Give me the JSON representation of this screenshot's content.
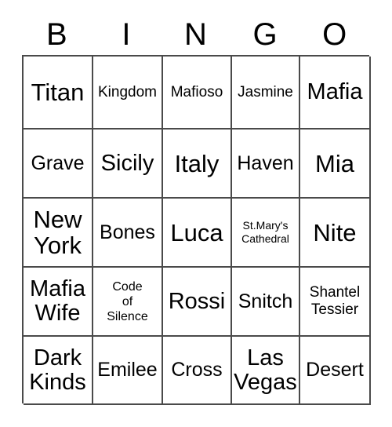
{
  "card": {
    "title": "BINGO",
    "header_letters": [
      "B",
      "I",
      "N",
      "G",
      "O"
    ],
    "border_color": "#4a4a4a",
    "background_color": "#ffffff",
    "text_color": "#000000",
    "columns": 5,
    "rows": 5
  },
  "grid": {
    "rows": [
      {
        "cells": [
          {
            "text": "Titan",
            "size": "xl"
          },
          {
            "text": "Kingdom",
            "size": "sm"
          },
          {
            "text": "Mafioso",
            "size": "sm"
          },
          {
            "text": "Jasmine",
            "size": "sm"
          },
          {
            "text": "Mafia",
            "size": "lg"
          }
        ]
      },
      {
        "cells": [
          {
            "text": "Grave",
            "size": "md"
          },
          {
            "text": "Sicily",
            "size": "lg"
          },
          {
            "text": "Italy",
            "size": "xl"
          },
          {
            "text": "Haven",
            "size": "md"
          },
          {
            "text": "Mia",
            "size": "xl"
          }
        ]
      },
      {
        "cells": [
          {
            "text": "New\nYork",
            "size": "xl"
          },
          {
            "text": "Bones",
            "size": "md"
          },
          {
            "text": "Luca",
            "size": "xl"
          },
          {
            "text": "St.Mary's\nCathedral",
            "size": "xxs"
          },
          {
            "text": "Nite",
            "size": "xl"
          }
        ]
      },
      {
        "cells": [
          {
            "text": "Mafia\nWife",
            "size": "lg"
          },
          {
            "text": "Code\nof\nSilence",
            "size": "xs"
          },
          {
            "text": "Rossi",
            "size": "lg"
          },
          {
            "text": "Snitch",
            "size": "md"
          },
          {
            "text": "Shantel\nTessier",
            "size": "sm"
          }
        ]
      },
      {
        "cells": [
          {
            "text": "Dark\nKinds",
            "size": "lg"
          },
          {
            "text": "Emilee",
            "size": "md"
          },
          {
            "text": "Cross",
            "size": "md"
          },
          {
            "text": "Las\nVegas",
            "size": "lg"
          },
          {
            "text": "Desert",
            "size": "md"
          }
        ]
      }
    ]
  }
}
